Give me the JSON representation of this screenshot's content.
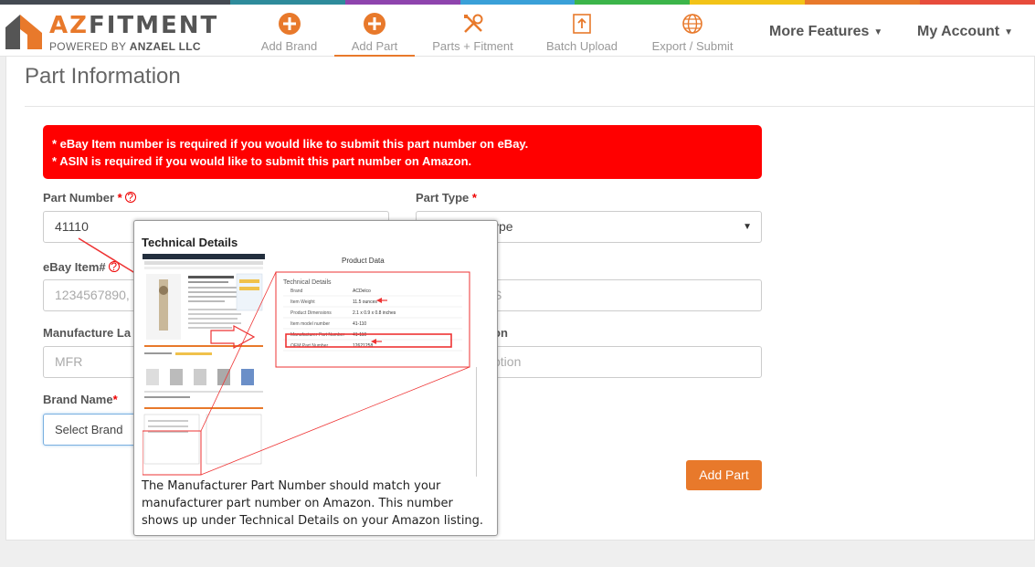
{
  "colors": {
    "top_strip": [
      "#444a52",
      "#444a52",
      "#2e8b9b",
      "#8e44ad",
      "#3aa0d8",
      "#3cb54a",
      "#f2c318",
      "#e8792b",
      "#e74c3c"
    ],
    "accent": "#e8792b",
    "alert_bg": "#ff0000"
  },
  "logo": {
    "brand_a": "AZ",
    "brand_rest": "FITMENT",
    "powered_by": "POWERED BY",
    "company": "ANZAEL LLC"
  },
  "nav": {
    "items": [
      {
        "label": "Add Brand",
        "icon": "plus-circle-icon"
      },
      {
        "label": "Add Part",
        "icon": "plus-circle-icon",
        "active": true
      },
      {
        "label": "Parts + Fitment",
        "icon": "tools-icon"
      },
      {
        "label": "Batch Upload",
        "icon": "upload-icon"
      },
      {
        "label": "Export / Submit",
        "icon": "globe-icon"
      }
    ],
    "more_features": "More Features",
    "my_account": "My Account"
  },
  "page": {
    "title": "Part Information",
    "alert_lines": [
      "* eBay Item number is required if you would like to submit this part number on eBay.",
      "* ASIN is required if you would like to submit this part number on Amazon."
    ]
  },
  "form": {
    "part_number": {
      "label": "Part Number",
      "value": "41110"
    },
    "part_type": {
      "label": "Part Type",
      "value": "ype"
    },
    "ebay_item": {
      "label": "eBay Item#",
      "placeholder": "1234567890,"
    },
    "asin": {
      "placeholder": "S"
    },
    "manufacture": {
      "label": "Manufacture La",
      "placeholder": "MFR"
    },
    "description": {
      "label": "on",
      "placeholder": "ption"
    },
    "brand_name": {
      "label": "Brand Name",
      "value": "Select Brand"
    },
    "add_part_button": "Add Part"
  },
  "popup": {
    "title": "Technical Details",
    "image_heading": "Product Data",
    "table_heading": "Technical Details",
    "rows": [
      {
        "k": "Brand",
        "v": "ACDelco"
      },
      {
        "k": "Item Weight",
        "v": "11.5 ounces"
      },
      {
        "k": "Product Dimensions",
        "v": "2.1 x 0.9 x 0.8 inches"
      },
      {
        "k": "Item model number",
        "v": "41-110"
      },
      {
        "k": "Manufacturer Part Number",
        "v": "41-110"
      },
      {
        "k": "OEM Part Number",
        "v": "12621258"
      }
    ],
    "text": "The Manufacturer Part Number should match your manufacturer part number on Amazon. This number shows up under Technical Details on your Amazon listing."
  }
}
